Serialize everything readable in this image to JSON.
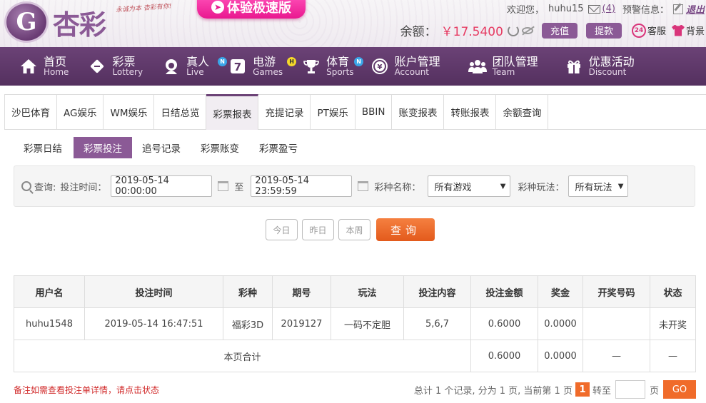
{
  "header": {
    "logo_mark": "G",
    "logo_text": "杏彩",
    "slogan": "永诚为本 杏彩有你!",
    "speed_button": "体验极速版",
    "welcome": "欢迎您，",
    "username": "huhu15",
    "mail_count": "(4)",
    "alert_label": "预警信息：",
    "logout": "退出",
    "balance_label": "余额：",
    "balance_value": "￥17.5400",
    "recharge": "充值",
    "withdraw": "提款",
    "cs_badge": "24",
    "customer_service": "客服",
    "background": "背景"
  },
  "nav": [
    {
      "cn": "首页",
      "en": "Home",
      "icon": "home-icon",
      "badge": ""
    },
    {
      "cn": "彩票",
      "en": "Lottery",
      "icon": "lottery-icon",
      "badge": ""
    },
    {
      "cn": "真人",
      "en": "Live",
      "icon": "live-icon",
      "badge": "N"
    },
    {
      "cn": "电游",
      "en": "Games",
      "icon": "games-icon",
      "badge": "H"
    },
    {
      "cn": "体育",
      "en": "Sports",
      "icon": "trophy-icon",
      "badge": "N"
    },
    {
      "cn": "账户管理",
      "en": "Account",
      "icon": "account-icon",
      "badge": ""
    },
    {
      "cn": "团队管理",
      "en": "Team",
      "icon": "team-icon",
      "badge": ""
    },
    {
      "cn": "优惠活动",
      "en": "Discount",
      "icon": "gift-icon",
      "badge": ""
    }
  ],
  "tabs": [
    "沙巴体育",
    "AG娱乐",
    "WM娱乐",
    "日结总览",
    "彩票报表",
    "充提记录",
    "PT娱乐",
    "BBIN",
    "账变报表",
    "转账报表",
    "余额查询"
  ],
  "subtabs": [
    "彩票日结",
    "彩票投注",
    "追号记录",
    "彩票账变",
    "彩票盈亏"
  ],
  "filter": {
    "query_label": "查询:",
    "time_label": "投注时间：",
    "start": "2019-05-14 00:00:00",
    "to": "至",
    "end": "2019-05-14 23:59:59",
    "lottery_label": "彩种名称：",
    "lottery_value": "所有游戏",
    "play_label": "彩种玩法：",
    "play_value": "所有玩法"
  },
  "quick": {
    "today": "今日",
    "yesterday": "昨日",
    "week": "本周",
    "query": "查询"
  },
  "table": {
    "headers": [
      "用户名",
      "投注时间",
      "彩种",
      "期号",
      "玩法",
      "投注内容",
      "投注金额",
      "奖金",
      "开奖号码",
      "状态"
    ],
    "rows": [
      [
        "huhu1548",
        "2019-05-14 16:47:51",
        "福彩3D",
        "2019127",
        "一码不定胆",
        "5,6,7",
        "0.6000",
        "0.0000",
        "",
        "未开奖"
      ]
    ],
    "total_label": "本页合计",
    "total_amount": "0.6000",
    "total_bonus": "0.0000",
    "total_numbers": "—",
    "total_status": "—"
  },
  "footer": {
    "note": "备注如需查看投注单详情，请点击状态",
    "pager_text": "总计 1 个记录, 分为 1 页, 当前第 1 页",
    "current_page": "1",
    "goto": "转至",
    "page_unit": "页",
    "go": "GO"
  }
}
